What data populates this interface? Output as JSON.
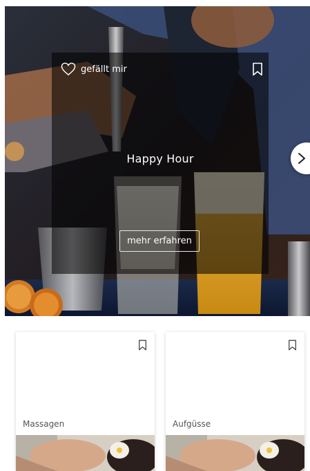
{
  "hero": {
    "like_label": "gefällt mir",
    "title": "Happy Hour",
    "cta_label": "mehr erfahren",
    "icons": {
      "like": "heart-icon",
      "bookmark": "bookmark-icon",
      "next": "chevron-right-icon"
    }
  },
  "tiles": [
    {
      "label": "Massagen",
      "icon": "bookmark-icon"
    },
    {
      "label": "Aufgüsse",
      "icon": "bookmark-icon"
    }
  ],
  "colors": {
    "overlay": "#000000",
    "text_light": "#ffffff",
    "tile_label": "#555555",
    "background": "#ffffff"
  }
}
